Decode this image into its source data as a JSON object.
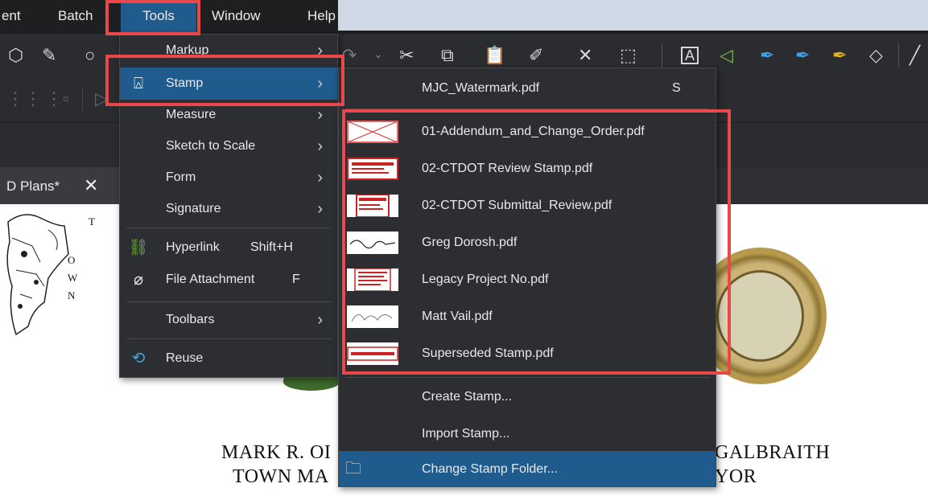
{
  "menubar": {
    "items": [
      "ent",
      "Batch",
      "Tools",
      "Window",
      "Help"
    ]
  },
  "tab": {
    "label": "D Plans*",
    "close": "✕"
  },
  "tools_menu": {
    "items": [
      {
        "label": "Markup",
        "shortcut": "",
        "icon": "",
        "submenu": true
      },
      {
        "label": "Stamp",
        "shortcut": "",
        "icon": "stamp-icon",
        "submenu": true
      },
      {
        "label": "Measure",
        "shortcut": "",
        "icon": "",
        "submenu": true
      },
      {
        "label": "Sketch to Scale",
        "shortcut": "",
        "icon": "",
        "submenu": true
      },
      {
        "label": "Form",
        "shortcut": "",
        "icon": "",
        "submenu": true
      },
      {
        "label": "Signature",
        "shortcut": "",
        "icon": "",
        "submenu": true
      },
      {
        "label": "Hyperlink",
        "shortcut": "Shift+H",
        "icon": "link-icon",
        "submenu": false
      },
      {
        "label": "File Attachment",
        "shortcut": "F",
        "icon": "paperclip-icon",
        "submenu": false
      },
      {
        "label": "Toolbars",
        "shortcut": "",
        "icon": "",
        "submenu": true
      },
      {
        "label": "Reuse",
        "shortcut": "",
        "icon": "reuse-icon",
        "submenu": false
      }
    ]
  },
  "stamp_menu": {
    "top": {
      "label": "MJC_Watermark.pdf",
      "shortcut": "S"
    },
    "stamps": [
      {
        "label": "01-Addendum_and_Change_Order.pdf"
      },
      {
        "label": "02-CTDOT Review Stamp.pdf"
      },
      {
        "label": "02-CTDOT Submittal_Review.pdf"
      },
      {
        "label": "Greg Dorosh.pdf"
      },
      {
        "label": "Legacy Project No.pdf"
      },
      {
        "label": "Matt Vail.pdf"
      },
      {
        "label": "Superseded Stamp.pdf"
      }
    ],
    "actions": [
      {
        "label": "Create Stamp..."
      },
      {
        "label": "Import Stamp..."
      },
      {
        "label": "Change Stamp Folder..."
      }
    ]
  },
  "document": {
    "line1_left": "MARK R. OI",
    "line2_left": "TOWN MA",
    "line1_right": "GALBRAITH",
    "line2_right": "YOR",
    "map_letters": [
      "T",
      "O",
      "W",
      "N"
    ]
  },
  "colors": {
    "menu_bg": "#2d2e31",
    "menubar_bg": "#1e1f21",
    "highlight": "#1f5b8c",
    "annotation": "#e8484a"
  }
}
